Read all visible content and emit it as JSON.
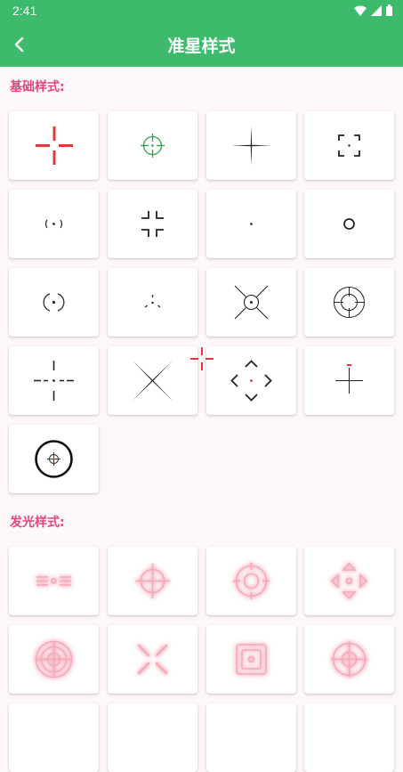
{
  "status_bar": {
    "time": "2:41",
    "icons": [
      "wifi-icon",
      "signal-icon",
      "battery-icon"
    ]
  },
  "app_bar": {
    "title": "准星样式",
    "back_icon": "back-arrow-icon",
    "background": "#3dba6b"
  },
  "sections": [
    {
      "title": "基础样式:",
      "items": [
        {
          "icon": "crosshair-red-plus-gap"
        },
        {
          "icon": "crosshair-green-scope"
        },
        {
          "icon": "crosshair-thin-tapered"
        },
        {
          "icon": "crosshair-corner-brackets"
        },
        {
          "icon": "crosshair-paren-dot"
        },
        {
          "icon": "crosshair-corner-plus"
        },
        {
          "icon": "crosshair-dot"
        },
        {
          "icon": "crosshair-ring"
        },
        {
          "icon": "crosshair-broken-circle-dot"
        },
        {
          "icon": "crosshair-triangle-dots"
        },
        {
          "icon": "crosshair-x-circle"
        },
        {
          "icon": "crosshair-double-ring"
        },
        {
          "icon": "crosshair-dashed-plus-dot"
        },
        {
          "icon": "crosshair-x-lines"
        },
        {
          "icon": "crosshair-diamond-chevrons"
        },
        {
          "icon": "crosshair-thin-plus-red-tick"
        },
        {
          "icon": "crosshair-bold-circle-scope"
        }
      ]
    },
    {
      "title": "发光样式:",
      "items": [
        {
          "icon": "glow-bars-dot"
        },
        {
          "icon": "glow-circle-plus"
        },
        {
          "icon": "glow-ring-scope"
        },
        {
          "icon": "glow-diamond-arrows"
        },
        {
          "icon": "glow-concentric-rings"
        },
        {
          "icon": "glow-x"
        },
        {
          "icon": "glow-square-frame"
        },
        {
          "icon": "glow-ring-scope-2"
        }
      ]
    }
  ],
  "colors": {
    "accent": "#3dba6b",
    "section_title": "#e8447a",
    "background": "#fdf7fc",
    "glow": "#f2a0b0"
  }
}
